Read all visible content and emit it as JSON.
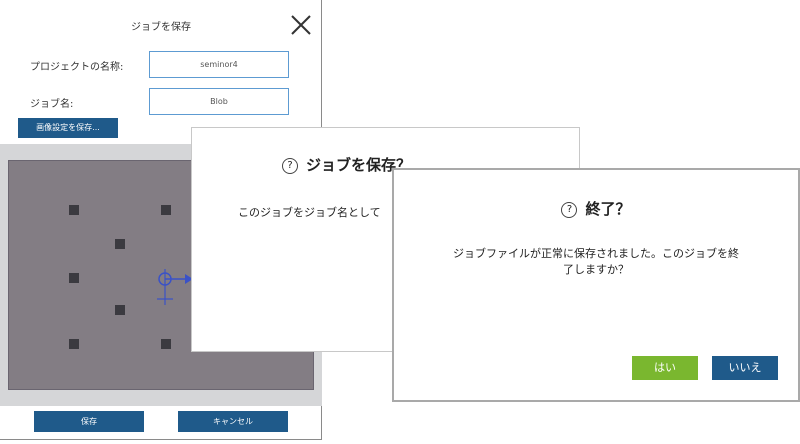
{
  "save_dialog": {
    "title": "ジョブを保存",
    "project_name_label": "プロジェクトの名称:",
    "project_name_value": "seminor4",
    "job_name_label": "ジョブ名:",
    "job_name_value": "Blob",
    "image_settings_button": "画像設定を保存...",
    "save_button": "保存",
    "cancel_button": "キャンセル"
  },
  "confirm_dialog": {
    "heading": "ジョブを保存？",
    "message": "このジョブをジョブ名として"
  },
  "exit_dialog": {
    "heading": "終了？",
    "message_line1": "ジョブファイルが正常に保存されました。このジョブを終",
    "message_line2": "了しますか？",
    "yes_button": "はい",
    "no_button": "いいえ"
  },
  "colors": {
    "primary_blue": "#1f5a8a",
    "yes_green": "#7ab72f",
    "field_border": "#5d9bd2"
  }
}
